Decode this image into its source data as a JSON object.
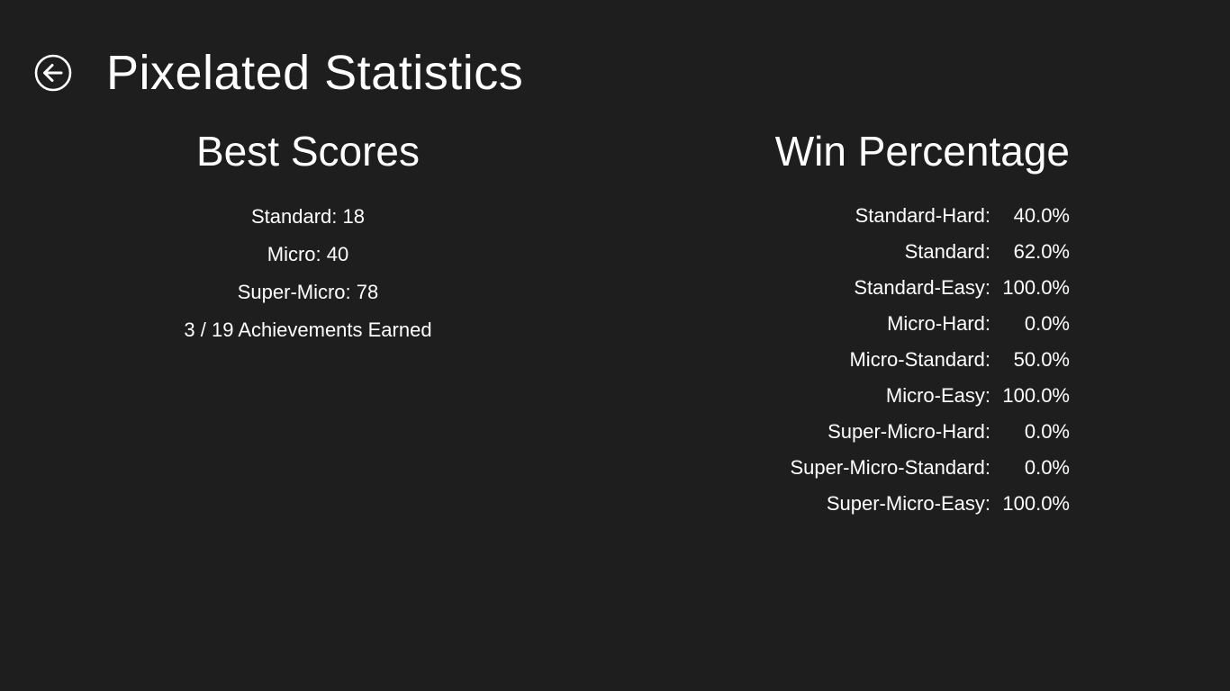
{
  "header": {
    "back_icon": "back-arrow-circle-icon",
    "title": "Pixelated Statistics"
  },
  "best_scores": {
    "heading": "Best Scores",
    "items": [
      "Standard: 18",
      "Micro: 40",
      "Super-Micro: 78",
      "3 / 19 Achievements Earned"
    ]
  },
  "win_percentage": {
    "heading": "Win Percentage",
    "rows": [
      {
        "label": "Standard-Hard:",
        "value": "40.0%"
      },
      {
        "label": "Standard:",
        "value": "62.0%"
      },
      {
        "label": "Standard-Easy:",
        "value": "100.0%"
      },
      {
        "label": "Micro-Hard:",
        "value": "0.0%"
      },
      {
        "label": "Micro-Standard:",
        "value": "50.0%"
      },
      {
        "label": "Micro-Easy:",
        "value": "100.0%"
      },
      {
        "label": "Super-Micro-Hard:",
        "value": "0.0%"
      },
      {
        "label": "Super-Micro-Standard:",
        "value": "0.0%"
      },
      {
        "label": "Super-Micro-Easy:",
        "value": "100.0%"
      }
    ]
  },
  "colors": {
    "background": "#1e1e1e",
    "text": "#ffffff"
  }
}
